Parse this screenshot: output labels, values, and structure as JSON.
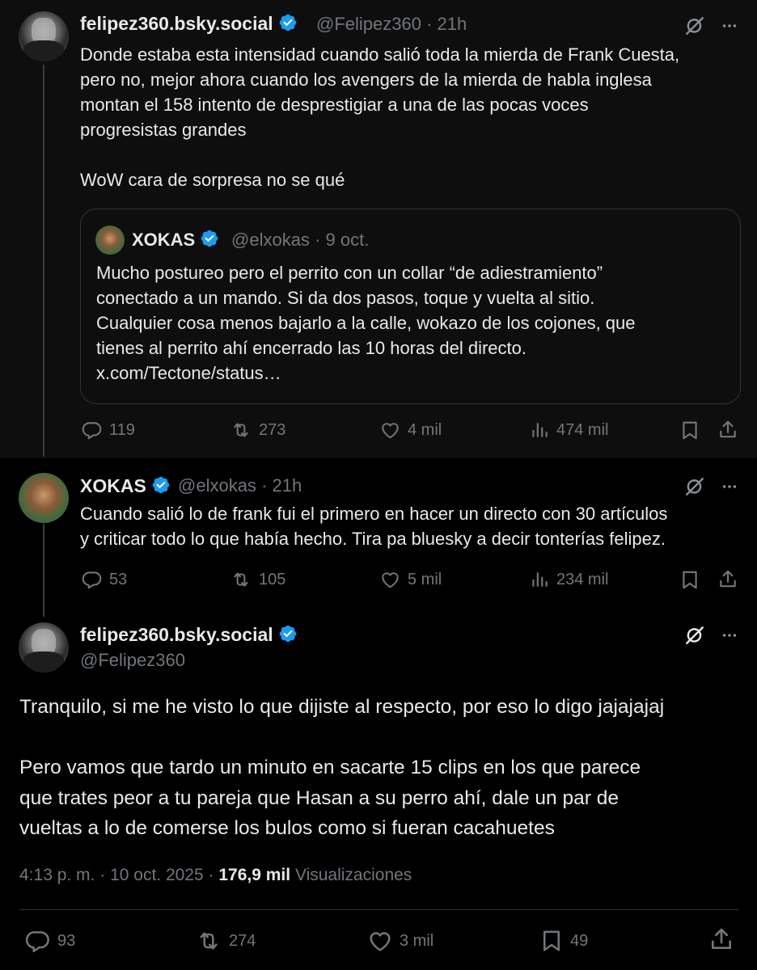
{
  "post1": {
    "name": "felipez360.bsky.social",
    "handle": "@Felipez360",
    "dot": "·",
    "time": "21h",
    "lines": [
      "Donde estaba esta intensidad cuando salió toda la mierda de Frank Cuesta,",
      "pero no, mejor ahora cuando los avengers de la mierda de habla inglesa",
      "montan el 158 intento de desprestigiar a una de las pocas voces",
      "progresistas grandes",
      "WoW cara de sorpresa no se qué"
    ],
    "quote": {
      "name": "XOKAS",
      "handle": "@elxokas",
      "dot": "·",
      "time": "9 oct.",
      "lines": [
        "Mucho postureo pero el perrito con un collar “de adiestramiento”",
        "conectado a un mando. Si da dos pasos, toque y vuelta al sitio.",
        "Cualquier cosa menos bajarlo a la calle, wokazo de los cojones, que",
        "tienes al perrito ahí encerrado las 10 horas del directo.",
        "x.com/Tectone/status…"
      ]
    },
    "actions": {
      "replies": "119",
      "reposts": "273",
      "likes": "4 mil",
      "views": "474 mil"
    }
  },
  "post2": {
    "name": "XOKAS",
    "handle": "@elxokas",
    "dot": "·",
    "time": "21h",
    "lines": [
      "Cuando salió lo de frank fui el primero en hacer un directo con 30 artículos",
      "y criticar todo lo que había hecho. Tira pa bluesky a decir tonterías felipez."
    ],
    "actions": {
      "replies": "53",
      "reposts": "105",
      "likes": "5 mil",
      "views": "234 mil"
    }
  },
  "post3": {
    "name": "felipez360.bsky.social",
    "handle": "@Felipez360",
    "lines": [
      "Tranquilo, si me he visto lo que dijiste al respecto, por eso lo digo jajajajaj",
      "Pero vamos que tardo un minuto en sacarte 15 clips en los que parece",
      "que trates peor a tu pareja que Hasan a su perro ahí, dale un par de",
      "vueltas a lo de comerse los bulos como si fueran cacahuetes"
    ],
    "meta": {
      "time": "4:13 p. m.",
      "dot": "·",
      "date": "10 oct. 2025",
      "dot2": "·",
      "views_count": "176,9 mil",
      "views_label": "Visualizaciones"
    },
    "actions": {
      "replies": "93",
      "reposts": "274",
      "likes": "3 mil",
      "bookmarks": "49"
    }
  },
  "colors": {
    "background": "#000000",
    "highlight": "#0e0e0e",
    "text": "#e7e9ea",
    "muted": "#71767b",
    "verified": "#1d9bf0",
    "border": "#2f3336"
  },
  "icons": [
    "verified-badge-icon",
    "grok-icon",
    "more-icon",
    "reply-icon",
    "repost-icon",
    "like-icon",
    "views-icon",
    "bookmark-icon",
    "share-icon"
  ]
}
